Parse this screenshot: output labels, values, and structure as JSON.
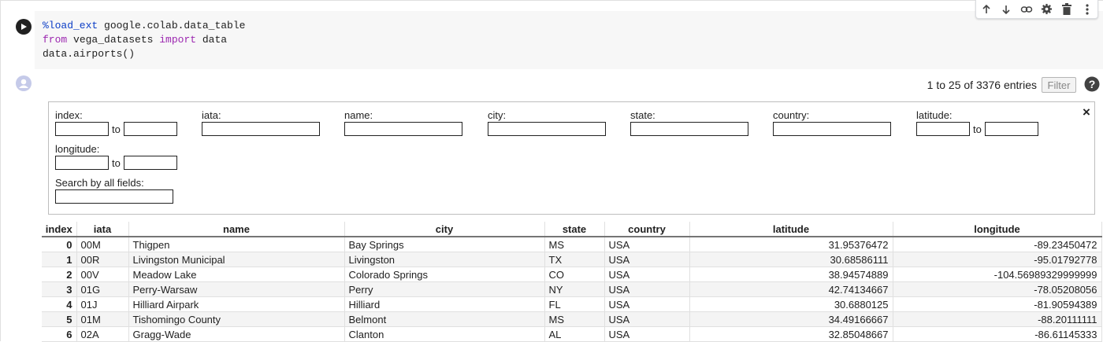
{
  "code_cell": {
    "lines": [
      {
        "parts": [
          {
            "text": "%load_ext",
            "cls": "kw-blue"
          },
          {
            "text": " google.colab.data_table",
            "cls": ""
          }
        ]
      },
      {
        "parts": [
          {
            "text": "from",
            "cls": "kw-purple"
          },
          {
            "text": " vega_datasets ",
            "cls": ""
          },
          {
            "text": "import",
            "cls": "kw-purple"
          },
          {
            "text": " data",
            "cls": ""
          }
        ]
      },
      {
        "parts": [
          {
            "text": "data.airports()",
            "cls": ""
          }
        ]
      }
    ],
    "toolbar_icons": [
      "arrow-up-icon",
      "arrow-down-icon",
      "link-icon",
      "gear-icon",
      "trash-icon",
      "more-vert-icon"
    ]
  },
  "output": {
    "entries_info": "1 to 25 of 3376 entries",
    "filter_button": "Filter",
    "help_icon": "help-icon",
    "filter_panel": {
      "close": "×",
      "to_label": "to",
      "fields": {
        "index": "index:",
        "iata": "iata:",
        "name": "name:",
        "city": "city:",
        "state": "state:",
        "country": "country:",
        "latitude": "latitude:",
        "longitude": "longitude:",
        "search_all": "Search by all fields:"
      }
    },
    "table": {
      "columns": [
        "index",
        "iata",
        "name",
        "city",
        "state",
        "country",
        "latitude",
        "longitude"
      ],
      "rows": [
        [
          "0",
          "00M",
          "Thigpen",
          "Bay Springs",
          "MS",
          "USA",
          "31.95376472",
          "-89.23450472"
        ],
        [
          "1",
          "00R",
          "Livingston Municipal",
          "Livingston",
          "TX",
          "USA",
          "30.68586111",
          "-95.01792778"
        ],
        [
          "2",
          "00V",
          "Meadow Lake",
          "Colorado Springs",
          "CO",
          "USA",
          "38.94574889",
          "-104.56989329999999"
        ],
        [
          "3",
          "01G",
          "Perry-Warsaw",
          "Perry",
          "NY",
          "USA",
          "42.74134667",
          "-78.05208056"
        ],
        [
          "4",
          "01J",
          "Hilliard Airpark",
          "Hilliard",
          "FL",
          "USA",
          "30.6880125",
          "-81.90594389"
        ],
        [
          "5",
          "01M",
          "Tishomingo County",
          "Belmont",
          "MS",
          "USA",
          "34.49166667",
          "-88.20111111"
        ],
        [
          "6",
          "02A",
          "Gragg-Wade",
          "Clanton",
          "AL",
          "USA",
          "32.85048667",
          "-86.61145333"
        ]
      ]
    }
  }
}
